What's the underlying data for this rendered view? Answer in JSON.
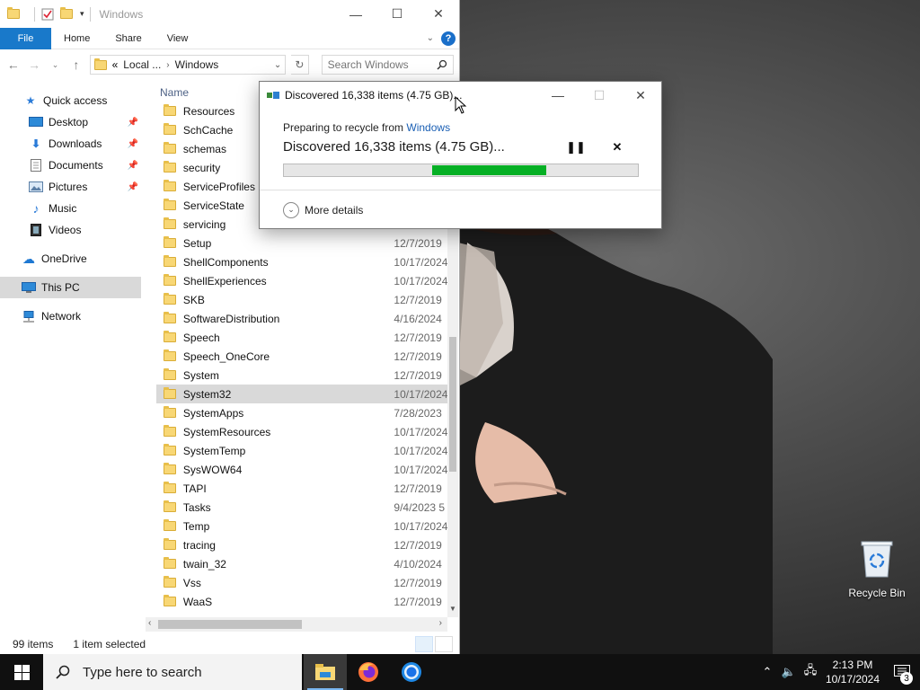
{
  "explorer": {
    "title": "Windows",
    "ribbon_tabs": [
      "File",
      "Home",
      "Share",
      "View"
    ],
    "address": {
      "prefix": "«",
      "crumbs": [
        "Local ...",
        "Windows"
      ]
    },
    "search_placeholder": "Search Windows",
    "column_name": "Name",
    "nav": {
      "quick_access": "Quick access",
      "desktop": "Desktop",
      "downloads": "Downloads",
      "documents": "Documents",
      "pictures": "Pictures",
      "music": "Music",
      "videos": "Videos",
      "onedrive": "OneDrive",
      "this_pc": "This PC",
      "network": "Network"
    },
    "rows": [
      {
        "name": "Resources",
        "date": ""
      },
      {
        "name": "SchCache",
        "date": ""
      },
      {
        "name": "schemas",
        "date": ""
      },
      {
        "name": "security",
        "date": ""
      },
      {
        "name": "ServiceProfiles",
        "date": ""
      },
      {
        "name": "ServiceState",
        "date": ""
      },
      {
        "name": "servicing",
        "date": "10/17/2024"
      },
      {
        "name": "Setup",
        "date": "12/7/2019"
      },
      {
        "name": "ShellComponents",
        "date": "10/17/2024"
      },
      {
        "name": "ShellExperiences",
        "date": "10/17/2024"
      },
      {
        "name": "SKB",
        "date": "12/7/2019"
      },
      {
        "name": "SoftwareDistribution",
        "date": "4/16/2024"
      },
      {
        "name": "Speech",
        "date": "12/7/2019"
      },
      {
        "name": "Speech_OneCore",
        "date": "12/7/2019"
      },
      {
        "name": "System",
        "date": "12/7/2019"
      },
      {
        "name": "System32",
        "date": "10/17/2024"
      },
      {
        "name": "SystemApps",
        "date": "7/28/2023"
      },
      {
        "name": "SystemResources",
        "date": "10/17/2024"
      },
      {
        "name": "SystemTemp",
        "date": "10/17/2024"
      },
      {
        "name": "SysWOW64",
        "date": "10/17/2024"
      },
      {
        "name": "TAPI",
        "date": "12/7/2019"
      },
      {
        "name": "Tasks",
        "date": "9/4/2023 5"
      },
      {
        "name": "Temp",
        "date": "10/17/2024"
      },
      {
        "name": "tracing",
        "date": "12/7/2019"
      },
      {
        "name": "twain_32",
        "date": "4/10/2024"
      },
      {
        "name": "Vss",
        "date": "12/7/2019"
      },
      {
        "name": "WaaS",
        "date": "12/7/2019"
      }
    ],
    "selected_row": "System32",
    "status": {
      "items": "99 items",
      "selected": "1 item selected"
    }
  },
  "dialog": {
    "title": "Discovered 16,338 items (4.75 GB)...",
    "preparing_prefix": "Preparing to recycle from ",
    "preparing_link": "Windows",
    "discovered": "Discovered 16,338 items (4.75 GB)...",
    "progress_indeterminate_fill": 0.32,
    "more_details": "More details",
    "progress_color": "#06b025"
  },
  "desktop": {
    "recycle_bin": "Recycle Bin"
  },
  "taskbar": {
    "search_placeholder": "Type here to search",
    "time": "2:13 PM",
    "date": "10/17/2024",
    "notification_count": "3",
    "apps": [
      "file-explorer-icon",
      "firefox-icon",
      "chrome-icon"
    ]
  }
}
